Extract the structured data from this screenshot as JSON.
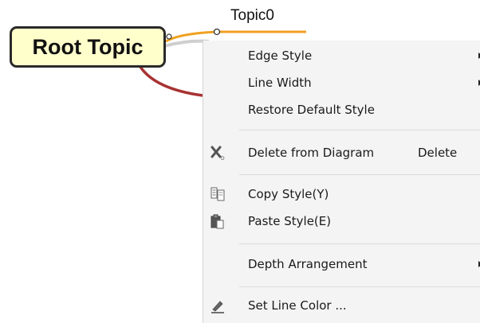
{
  "diagram": {
    "root_topic": "Root Topic",
    "topic0": "Topic0"
  },
  "context_menu": {
    "items": [
      {
        "label": "Edge Style",
        "submenu": true
      },
      {
        "label": "Line Width",
        "submenu": true
      },
      {
        "label": "Restore Default Style"
      },
      {
        "label": "Delete from Diagram",
        "shortcut": "Delete",
        "icon": "delete-x-icon"
      },
      {
        "label": "Copy Style(Y)",
        "icon": "copy-style-icon"
      },
      {
        "label": "Paste Style(E)",
        "icon": "paste-style-icon"
      },
      {
        "label": "Depth Arrangement",
        "submenu": true
      },
      {
        "label": "Set Line Color ...",
        "icon": "pen-icon"
      }
    ]
  },
  "colors": {
    "topic_edge": "#f0a020",
    "dark_red_edge": "#a83232",
    "root_fill": "#ffffcc"
  }
}
